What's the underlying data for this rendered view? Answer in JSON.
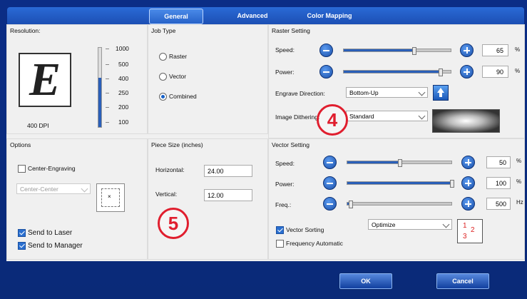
{
  "tabs": [
    {
      "label": "General",
      "active": true
    },
    {
      "label": "Advanced",
      "active": false
    },
    {
      "label": "Color Mapping",
      "active": false
    }
  ],
  "resolution": {
    "title": "Resolution:",
    "preview_letter": "E",
    "dpi_label": "400 DPI",
    "ticks": [
      "1000",
      "500",
      "400",
      "250",
      "200",
      "100"
    ]
  },
  "job_type": {
    "title": "Job Type",
    "options": [
      "Raster",
      "Vector",
      "Combined"
    ],
    "selected": "Combined"
  },
  "raster": {
    "title": "Raster Setting",
    "speed_label": "Speed:",
    "speed_value": "65",
    "speed_percent": 65,
    "power_label": "Power:",
    "power_value": "90",
    "power_percent": 90,
    "unit": "%",
    "direction_label": "Engrave Direction:",
    "direction_value": "Bottom-Up",
    "dithering_label": "Image Dithering:",
    "dithering_value": "Standard"
  },
  "options": {
    "title": "Options",
    "center_engraving_label": "Center-Engraving",
    "center_engraving_checked": false,
    "position_select": "Center-Center",
    "send_to_laser_label": "Send to Laser",
    "send_to_laser_checked": true,
    "send_to_manager_label": "Send to Manager",
    "send_to_manager_checked": true
  },
  "piece_size": {
    "title": "Piece Size (inches)",
    "horizontal_label": "Horizontal:",
    "horizontal_value": "24.00",
    "vertical_label": "Vertical:",
    "vertical_value": "12.00"
  },
  "vector": {
    "title": "Vector Setting",
    "speed_label": "Speed:",
    "speed_value": "50",
    "speed_percent": 50,
    "power_label": "Power:",
    "power_value": "100",
    "power_percent": 100,
    "freq_label": "Freq.:",
    "freq_value": "500",
    "freq_percent": 3,
    "unit_percent": "%",
    "unit_hz": "Hz",
    "vector_sorting_label": "Vector Sorting",
    "vector_sorting_checked": true,
    "sorting_select": "Optimize",
    "frequency_auto_label": "Frequency Automatic",
    "frequency_auto_checked": false
  },
  "buttons": {
    "ok": "OK",
    "cancel": "Cancel"
  },
  "annotations": {
    "badge_4": "4",
    "badge_5": "5"
  },
  "colors": {
    "accent": "#1560c8",
    "badge": "#e01e2e",
    "frame": "#0b2d86"
  }
}
